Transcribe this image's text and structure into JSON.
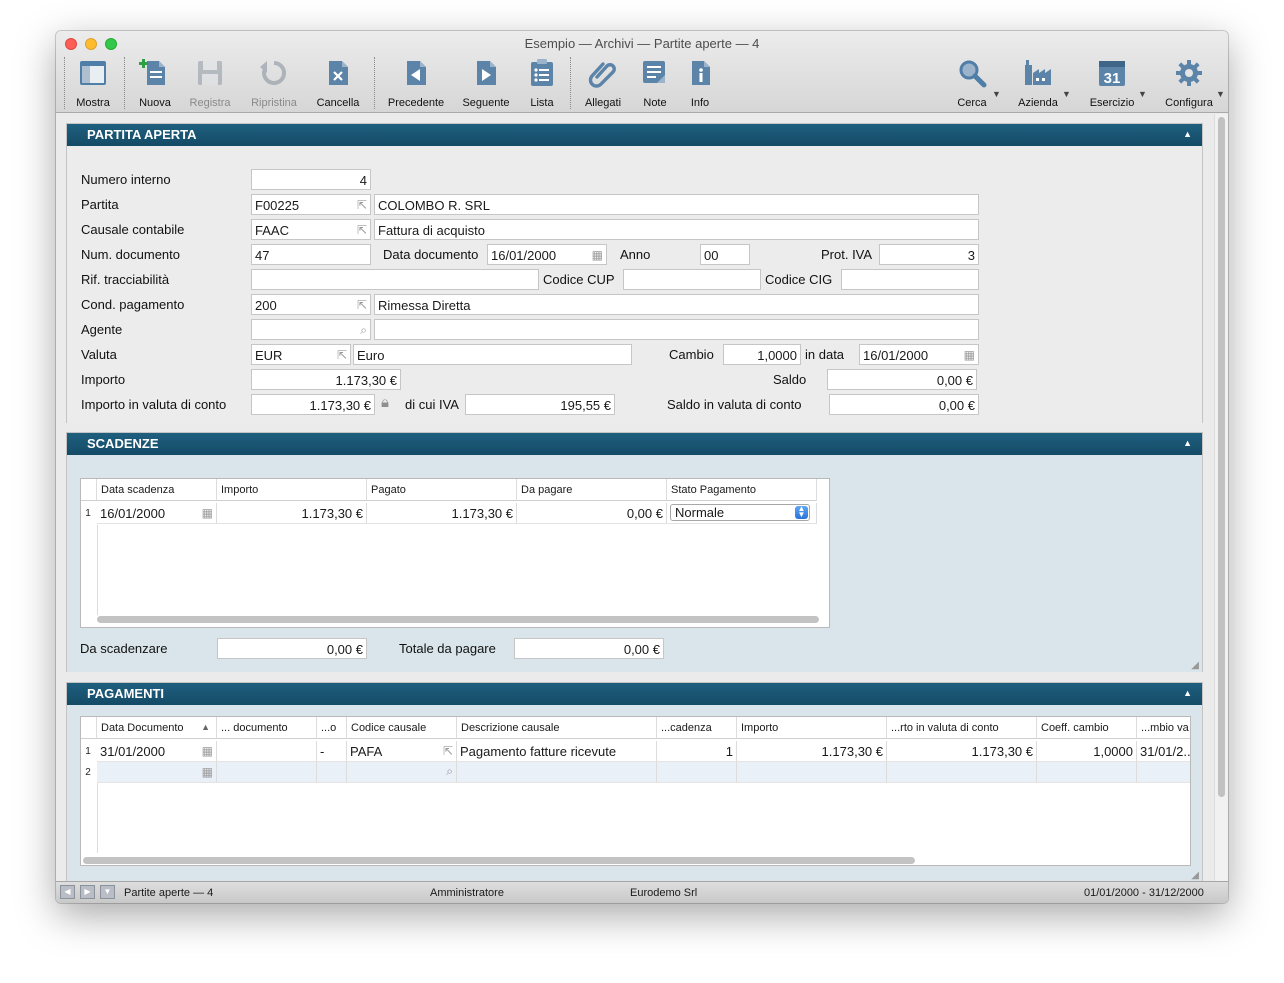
{
  "window": {
    "title": "Esempio — Archivi — Partite aperte — 4"
  },
  "toolbar": {
    "mostra": "Mostra",
    "nuova": "Nuova",
    "registra": "Registra",
    "ripristina": "Ripristina",
    "cancella": "Cancella",
    "precedente": "Precedente",
    "seguente": "Seguente",
    "lista": "Lista",
    "allegati": "Allegati",
    "note": "Note",
    "info": "Info",
    "cerca": "Cerca",
    "azienda": "Azienda",
    "esercizio": "Esercizio",
    "esercizio_day": "31",
    "configura": "Configura"
  },
  "partita": {
    "header": "PARTITA APERTA",
    "labels": {
      "numero_interno": "Numero interno",
      "partita": "Partita",
      "causale": "Causale contabile",
      "num_documento": "Num. documento",
      "data_documento": "Data documento",
      "anno": "Anno",
      "prot_iva": "Prot. IVA",
      "rif_tracciabilita": "Rif. tracciabilità",
      "codice_cup": "Codice CUP",
      "codice_cig": "Codice CIG",
      "cond_pagamento": "Cond. pagamento",
      "agente": "Agente",
      "valuta": "Valuta",
      "cambio": "Cambio",
      "in_data": "in data",
      "importo": "Importo",
      "saldo": "Saldo",
      "importo_valuta_conto": "Importo in valuta di conto",
      "di_cui_iva": "di cui IVA",
      "saldo_valuta_conto": "Saldo in valuta di conto"
    },
    "values": {
      "numero_interno": "4",
      "partita_code": "F00225",
      "partita_name": "COLOMBO R. SRL",
      "causale_code": "FAAC",
      "causale_desc": "Fattura di acquisto",
      "num_documento": "47",
      "data_documento": "16/01/2000",
      "anno": "00",
      "prot_iva": "3",
      "rif_tracciabilita": "",
      "codice_cup": "",
      "codice_cig": "",
      "cond_pagamento_code": "200",
      "cond_pagamento_desc": "Rimessa Diretta",
      "agente_code": "",
      "agente_desc": "",
      "valuta_code": "EUR",
      "valuta_desc": "Euro",
      "cambio": "1,0000",
      "cambio_data": "16/01/2000",
      "importo": "1.173,30 €",
      "saldo": "0,00 €",
      "importo_valuta_conto": "1.173,30 €",
      "di_cui_iva": "195,55 €",
      "saldo_valuta_conto": "0,00 €"
    }
  },
  "scadenze": {
    "header": "SCADENZE",
    "columns": [
      "Data scadenza",
      "Importo",
      "Pagato",
      "Da pagare",
      "Stato Pagamento"
    ],
    "rows": [
      {
        "n": "1",
        "data": "16/01/2000",
        "importo": "1.173,30 €",
        "pagato": "1.173,30 €",
        "da_pagare": "0,00 €",
        "stato": "Normale"
      }
    ],
    "da_scadenzare_label": "Da scadenzare",
    "da_scadenzare": "0,00 €",
    "totale_da_pagare_label": "Totale da pagare",
    "totale_da_pagare": "0,00 €"
  },
  "pagamenti": {
    "header": "PAGAMENTI",
    "columns": [
      "Data Documento",
      "... documento",
      "...o",
      "Codice causale",
      "Descrizione causale",
      "...cadenza",
      "Importo",
      "...rto in valuta di conto",
      "Coeff. cambio",
      "...mbio va"
    ],
    "rows": [
      {
        "n": "1",
        "data": "31/01/2000",
        "documento": "",
        "o": "-",
        "codice": "PAFA",
        "descrizione": "Pagamento fatture ricevute",
        "scadenza": "1",
        "importo": "1.173,30 €",
        "importo_conto": "1.173,30 €",
        "coeff": "1,0000",
        "data_cambio": "31/01/2..."
      },
      {
        "n": "2"
      }
    ],
    "sort_indicator": "▲"
  },
  "status": {
    "record": "Partite aperte — 4",
    "user": "Amministratore",
    "company": "Eurodemo Srl",
    "period": "01/01/2000 - 31/12/2000"
  }
}
